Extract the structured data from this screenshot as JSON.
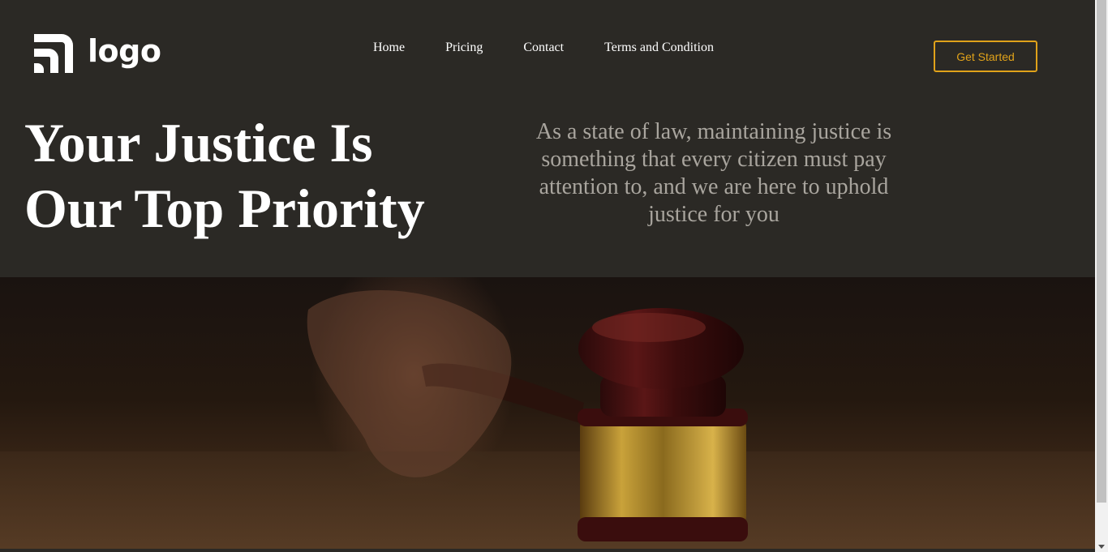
{
  "brand": {
    "logo_text": "logo"
  },
  "nav": {
    "items": [
      {
        "label": "Home"
      },
      {
        "label": "Pricing"
      },
      {
        "label": "Contact"
      },
      {
        "label": "Terms and Condition"
      }
    ]
  },
  "cta": {
    "label": "Get Started"
  },
  "hero": {
    "headline_line1": "Your Justice Is",
    "headline_line2": "Our Top Priority",
    "description": "As a state of law, maintaining justice is something that every citizen must pay attention to, and we are here to uphold justice for you"
  },
  "colors": {
    "background": "#2b2925",
    "accent": "#e0a21a",
    "headline": "#ffffff",
    "subtext": "#a9a59e"
  }
}
